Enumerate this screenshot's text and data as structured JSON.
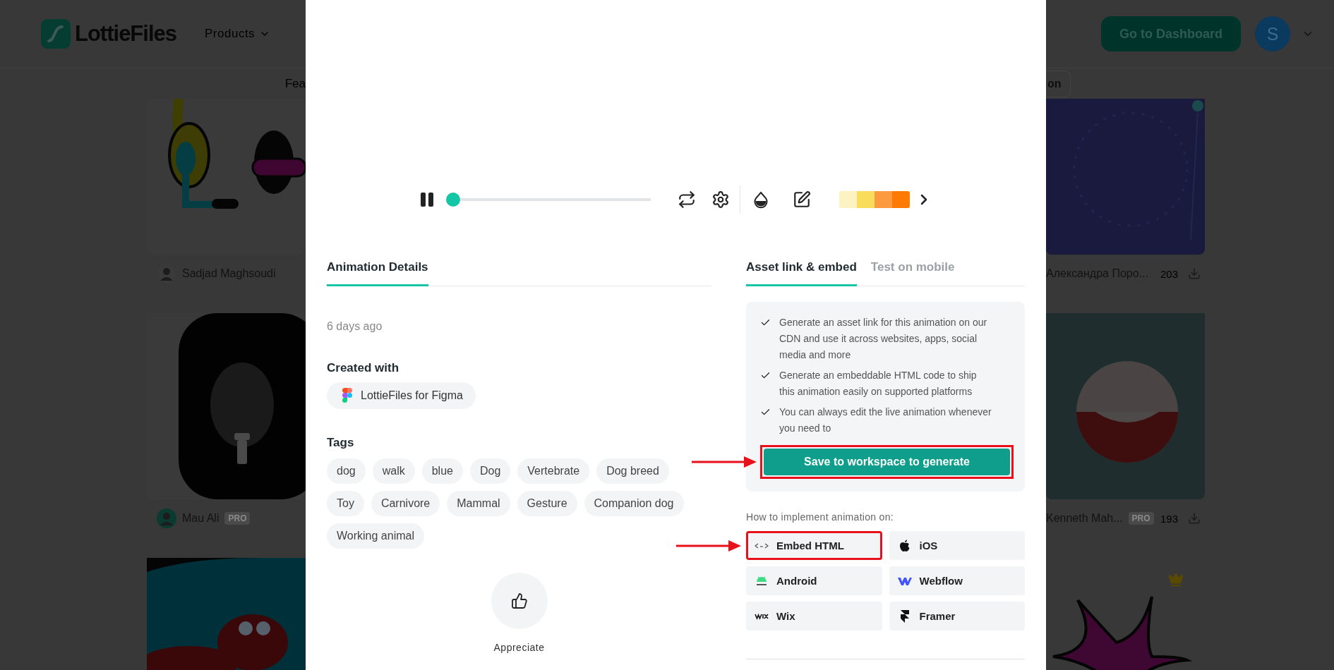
{
  "header": {
    "logo": "LottieFiles",
    "nav": [
      {
        "label": "Products"
      }
    ],
    "subnav_fragment": "Fea",
    "subnav_button_fragment": "on",
    "dashboard_button": "Go to Dashboard",
    "avatar": "S"
  },
  "gallery_left": [
    {
      "kind": "picture",
      "author": "Sadjad Maghsoudi"
    },
    {
      "kind": "picture",
      "author": "Mau Ali",
      "badge": "PRO"
    },
    {
      "kind": "picture"
    }
  ],
  "gallery_right": [
    {
      "kind": "picture",
      "author": "Александра Поро...",
      "downloads": "203"
    },
    {
      "kind": "picture",
      "author": "Kenneth Mah...",
      "badge": "PRO",
      "downloads": "193"
    },
    {
      "kind": "picture",
      "premium": true
    }
  ],
  "modal": {
    "player": {
      "playing": true,
      "level": 0,
      "palette": [
        {
          "color": "#fdf3c2"
        },
        {
          "color": "#f8dc5a"
        },
        {
          "color": "#fd9a40"
        },
        {
          "color": "#fd7b04"
        }
      ]
    },
    "details": {
      "tabs": [
        {
          "label": "Animation Details",
          "selected": true
        }
      ],
      "date": "6 days ago",
      "created_with_label": "Created with",
      "created_with": "LottieFiles for Figma",
      "tags_label": "Tags",
      "tags": [
        "dog",
        "walk",
        "blue",
        "Dog",
        "Vertebrate",
        "Dog breed",
        "Toy",
        "Carnivore",
        "Mammal",
        "Gesture",
        "Companion dog",
        "Working animal"
      ],
      "appreciate": "Appreciate"
    },
    "embed": {
      "tabs": [
        {
          "label": "Asset link & embed",
          "selected": true
        },
        {
          "label": "Test on mobile",
          "selected": false
        }
      ],
      "benefits": [
        "Generate an asset link for this animation on our CDN and use it across websites, apps, social media and more",
        "Generate an embeddable HTML code to ship this animation easily on supported platforms",
        "You can always edit the live animation whenever you need to"
      ],
      "save_button": {
        "label": "Save to workspace to generate",
        "highlighted": true
      },
      "platforms_label": "How to implement animation on:",
      "platforms": [
        {
          "label": "Embed HTML",
          "kind": "html",
          "highlighted": true
        },
        {
          "label": "iOS",
          "kind": "apple",
          "highlighted": false
        },
        {
          "label": "Android",
          "kind": "android",
          "highlighted": false
        },
        {
          "label": "Webflow",
          "kind": "webflow",
          "highlighted": false
        },
        {
          "label": "Wix",
          "kind": "wix",
          "highlighted": false
        },
        {
          "label": "Framer",
          "kind": "framer",
          "highlighted": false
        }
      ]
    }
  }
}
